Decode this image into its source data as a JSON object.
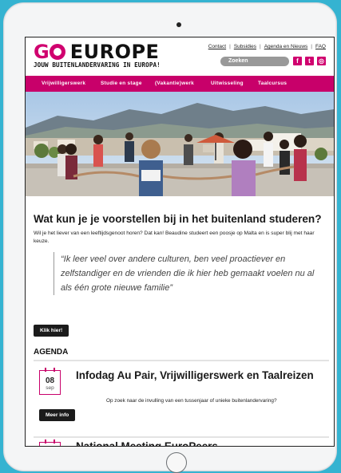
{
  "brand": {
    "go": "G",
    "go2": "",
    "europe": "EUROPE",
    "tagline": "JOUW BUITENLANDERVARING IN EUROPA!"
  },
  "toplinks": [
    "Contact",
    "Subsidies",
    "Agenda en Nieuws",
    "FAQ"
  ],
  "search": {
    "placeholder": "Zoeken"
  },
  "social": [
    {
      "icon": "facebook-icon",
      "glyph": "f"
    },
    {
      "icon": "twitter-icon",
      "glyph": "t"
    },
    {
      "icon": "instagram-icon",
      "glyph": "◎"
    }
  ],
  "nav": [
    "Vrijwilligerswerk",
    "Studie en stage",
    "(Vakantie)werk",
    "Uitwisseling",
    "Taalcursus"
  ],
  "article": {
    "title": "Wat kun je je voorstellen bij in het buitenland studeren?",
    "intro": "Wil je het liever van een leeftijdsgenoot horen? Dat kan! Beaudine studeert een poosje op Malta en is super blij met haar keuze.",
    "quote": "“Ik leer veel over andere culturen, ben veel proactiever en zelfstandiger en de vrienden die ik hier heb gemaakt voelen nu al als één grote nieuwe familie”",
    "button": "Klik hier!"
  },
  "agenda": {
    "heading": "AGENDA",
    "events": [
      {
        "day": "08",
        "month": "sep",
        "title": "Infodag Au Pair, Vrijwilligerswerk en Taalreizen",
        "desc": "Op zoek naar de invulling van een tussenjaar of unieke buitenlandervaring?",
        "button": "Meer info"
      },
      {
        "title": "National Meeting EuroPeers"
      }
    ]
  },
  "colors": {
    "brand": "#c8006a",
    "background": "#35b3d1"
  }
}
